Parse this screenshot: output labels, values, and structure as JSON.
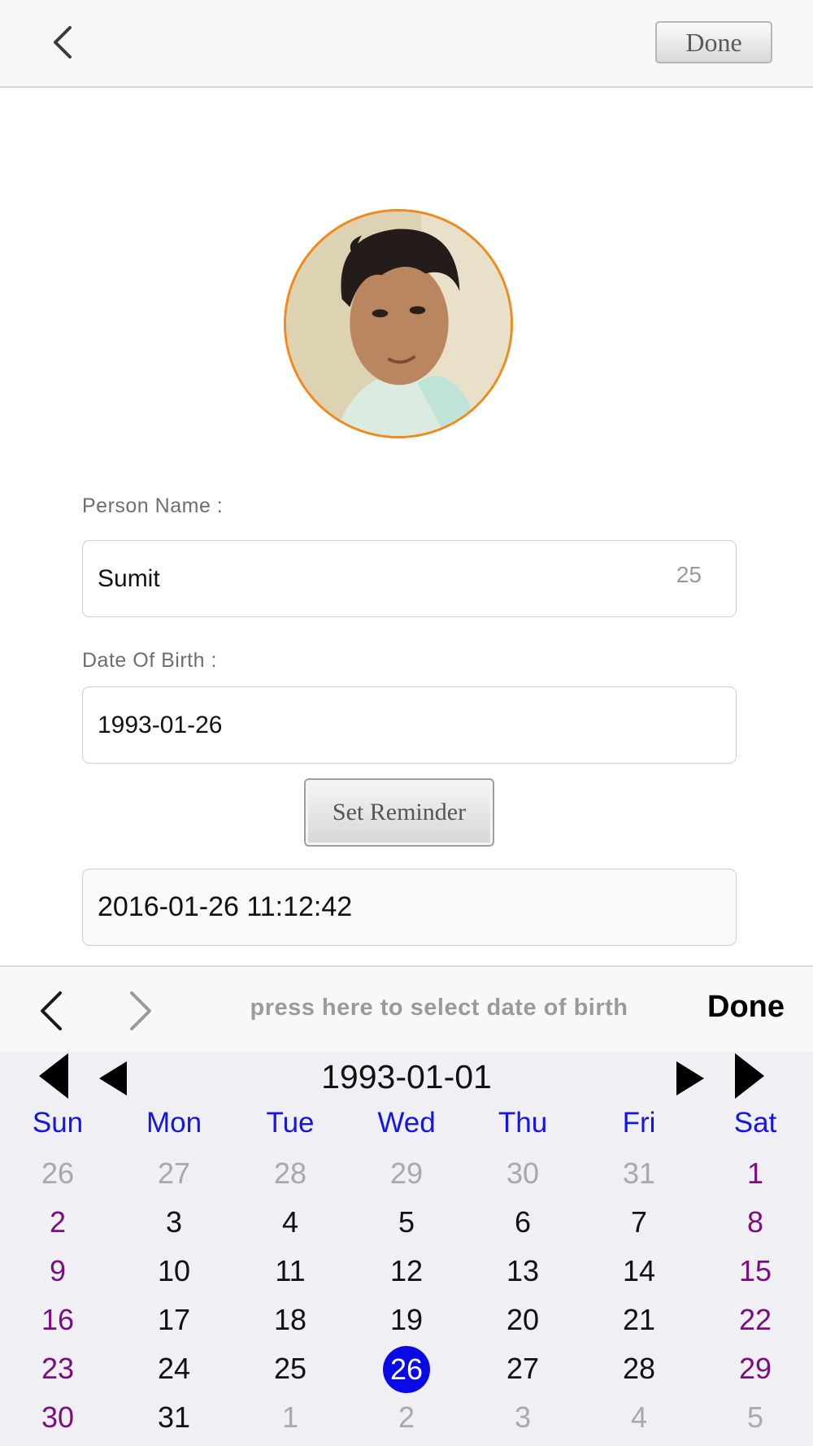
{
  "header": {
    "done_label": "Done",
    "back_icon": "chevron-left-icon"
  },
  "profile": {
    "avatar_icon": "avatar-photo"
  },
  "form": {
    "name_label": "Person Name :",
    "name_value": "Sumit",
    "name_counter": "25",
    "dob_label": "Date Of Birth :",
    "dob_value": "1993-01-26",
    "reminder_button": "Set Reminder",
    "reminder_value": "2016-01-26 11:12:42"
  },
  "toolbar": {
    "hint": "press here to select date of birth",
    "done_label": "Done",
    "prev_icon": "chevron-left-icon",
    "next_icon": "chevron-right-icon"
  },
  "calendar": {
    "title": "1993-01-01",
    "weekdays": [
      "Sun",
      "Mon",
      "Tue",
      "Wed",
      "Thu",
      "Fri",
      "Sat"
    ],
    "weeks": [
      [
        "26",
        "27",
        "28",
        "29",
        "30",
        "31",
        "1"
      ],
      [
        "2",
        "3",
        "4",
        "5",
        "6",
        "7",
        "8"
      ],
      [
        "9",
        "10",
        "11",
        "12",
        "13",
        "14",
        "15"
      ],
      [
        "16",
        "17",
        "18",
        "19",
        "20",
        "21",
        "22"
      ],
      [
        "23",
        "24",
        "25",
        "26",
        "27",
        "28",
        "29"
      ],
      [
        "30",
        "31",
        "1",
        "2",
        "3",
        "4",
        "5"
      ]
    ],
    "selected_day": "26",
    "colors": {
      "weekday": "#1414e8",
      "weekend": "#7b0d7f",
      "muted": "#a9a9a9",
      "selected": "#0a0ae6"
    }
  }
}
